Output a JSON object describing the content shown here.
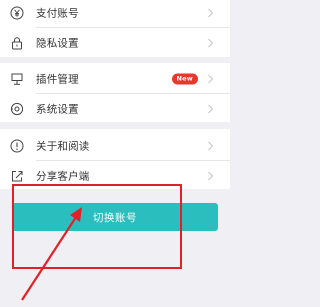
{
  "menu": {
    "group1": [
      {
        "label": "支付账号",
        "icon": "yen-circle-icon"
      },
      {
        "label": "隐私设置",
        "icon": "lock-icon"
      }
    ],
    "group2": [
      {
        "label": "插件管理",
        "icon": "plugin-icon",
        "badge": "New"
      },
      {
        "label": "系统设置",
        "icon": "gear-icon"
      }
    ],
    "group3": [
      {
        "label": "关于和阅读",
        "icon": "info-circle-icon"
      },
      {
        "label": "分享客户端",
        "icon": "share-icon"
      }
    ]
  },
  "actions": {
    "switch_account_label": "切换账号"
  },
  "colors": {
    "accent": "#2abfbe",
    "badge": "#e8372b",
    "annotation": "#e3202a",
    "background": "#efeff4"
  }
}
